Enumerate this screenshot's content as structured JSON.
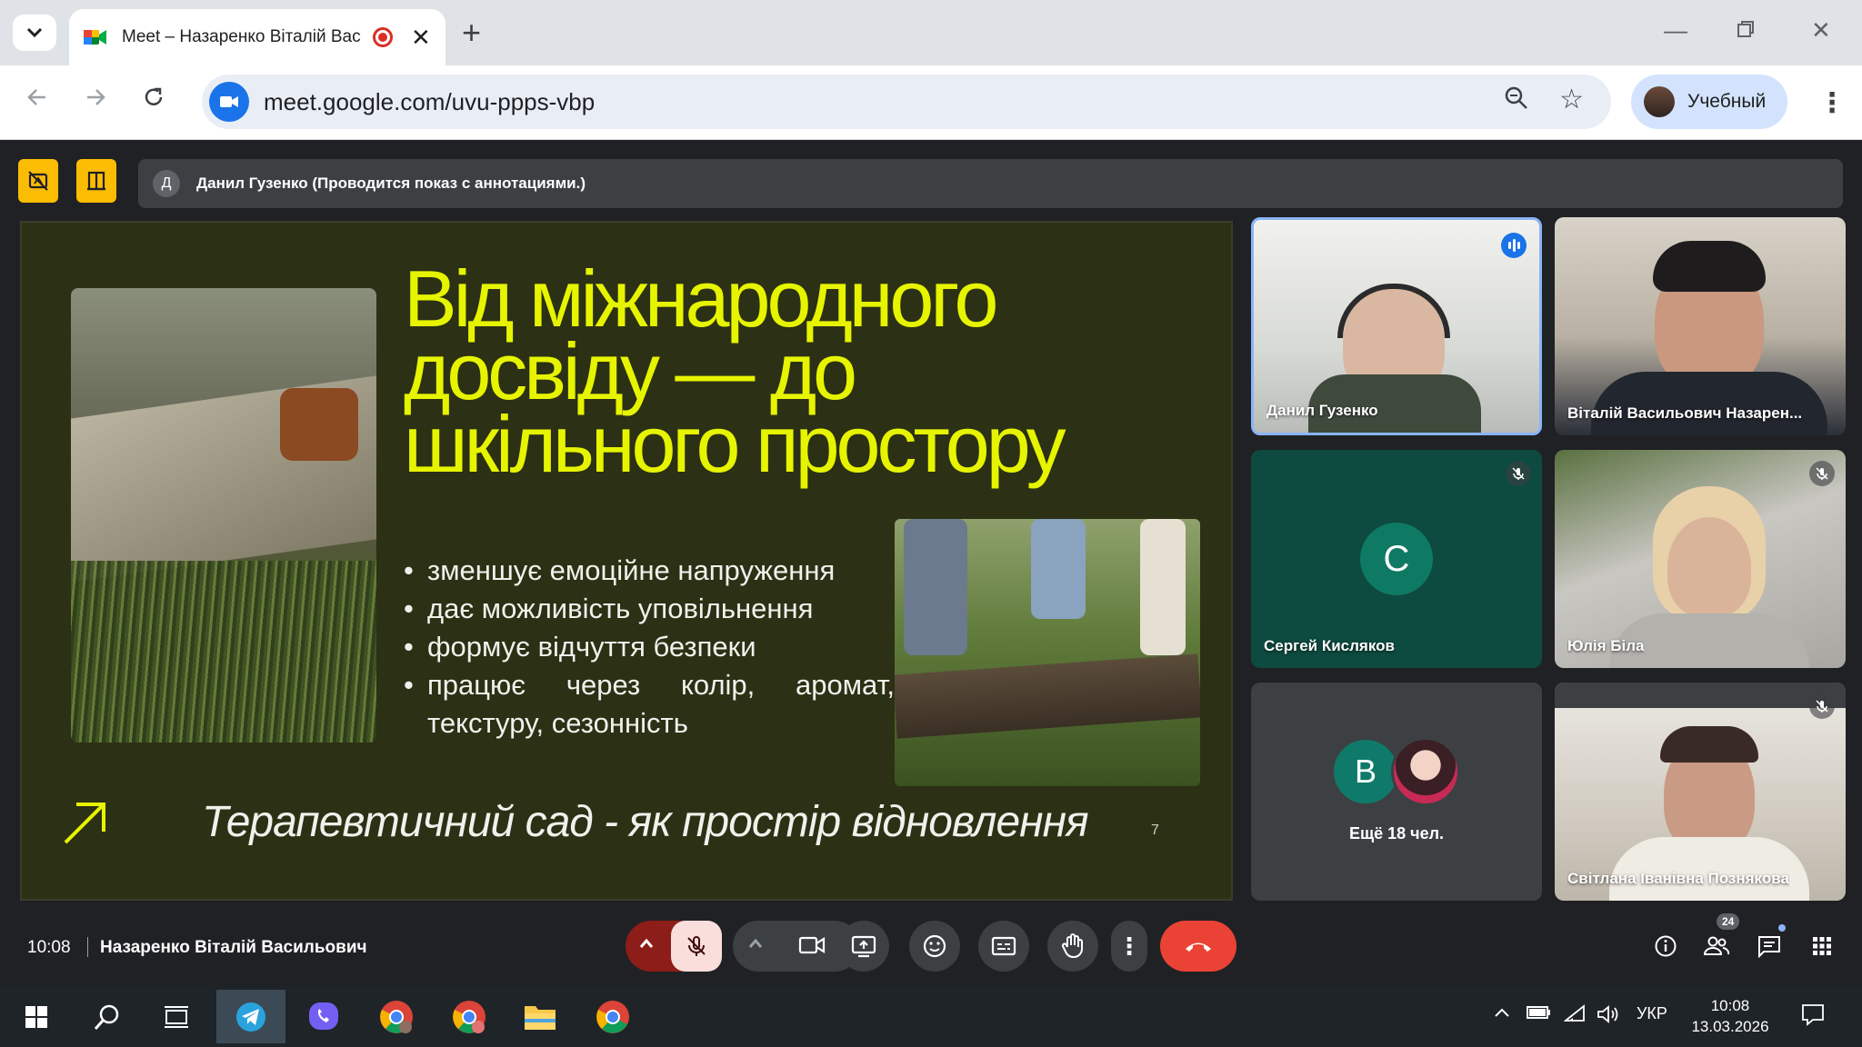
{
  "browser": {
    "tab_title": "Meet – Назаренко Віталій Вас",
    "url": "meet.google.com/uvu-ppps-vbp",
    "profile_name": "Учебный"
  },
  "meet": {
    "presenter_banner": "Данил Гузенко (Проводится показ с аннотациями.)",
    "presenter_initial": "Д",
    "clock": "10:08",
    "meeting_name": "Назаренко Віталій Васильович",
    "participants_count": "24"
  },
  "slide": {
    "title": "Від міжнародного досвіду — до шкільного простору",
    "bullets": [
      "зменшує емоційне напруження",
      "дає можливість уповільнення",
      "формує відчуття безпеки",
      "працює через колір, аромат, текстуру, сезонність"
    ],
    "footer": "Терапевтичний сад - як простір відновлення",
    "page": "7",
    "title_color": "#e6f400"
  },
  "tiles": [
    {
      "name": "Данил Гузенко",
      "state": "speaking"
    },
    {
      "name": "Віталій Васильович Назарен..."
    },
    {
      "name": "Сергей Кисляков",
      "initial": "С",
      "state": "muted"
    },
    {
      "name": "Юлія Біла",
      "state": "muted"
    },
    {
      "more_label": "Ещё 18 чел.",
      "initial": "В"
    },
    {
      "name": "Світлана Іванівна Познякова",
      "state": "muted"
    }
  ],
  "taskbar": {
    "language": "УКР",
    "time": "10:08",
    "date": "13.03.2026"
  }
}
